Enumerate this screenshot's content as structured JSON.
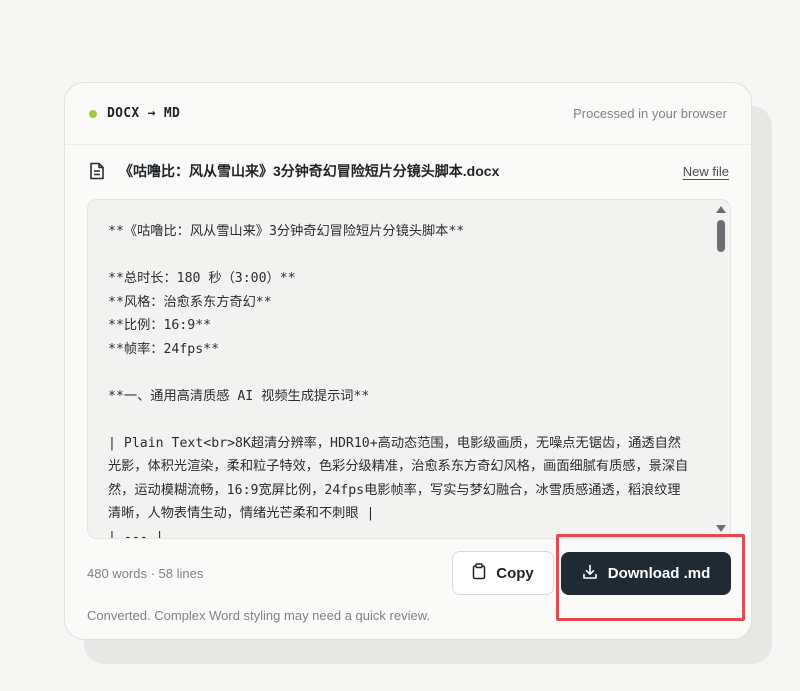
{
  "header": {
    "brand_label": "DOCX → MD",
    "processed_note": "Processed in your browser"
  },
  "file": {
    "name": "《咕噜比：风从雪山来》3分钟奇幻冒险短片分镜头脚本.docx",
    "new_file_label": "New file"
  },
  "editor": {
    "lines": [
      "**《咕噜比：风从雪山来》3分钟奇幻冒险短片分镜头脚本**",
      "",
      "**总时长：180 秒（3:00）**",
      "**风格：治愈系东方奇幻**",
      "**比例：16:9**",
      "**帧率：24fps**",
      "",
      "**一、通用高清质感 AI 视频生成提示词**",
      "",
      "| Plain Text<br>8K超清分辨率，HDR10+高动态范围，电影级画质，无噪点无锯齿，通透自然光影，体积光渲染，柔和粒子特效，色彩分级精准，治愈系东方奇幻风格，画面细腻有质感，景深自然，运动模糊流畅，16:9宽屏比例，24fps电影帧率，写实与梦幻融合，冰雪质感通透，稻浪纹理清晰，人物表情生动，情绪光芒柔和不刺眼 |",
      "| --- |"
    ]
  },
  "footer": {
    "stats": "480 words · 58 lines",
    "copy_label": "Copy",
    "download_label": "Download .md",
    "status": "Converted. Complex Word styling may need a quick review."
  },
  "colors": {
    "accent_dot": "#a3c93a",
    "download_bg": "#1f2a33",
    "highlight": "#e5484d"
  }
}
